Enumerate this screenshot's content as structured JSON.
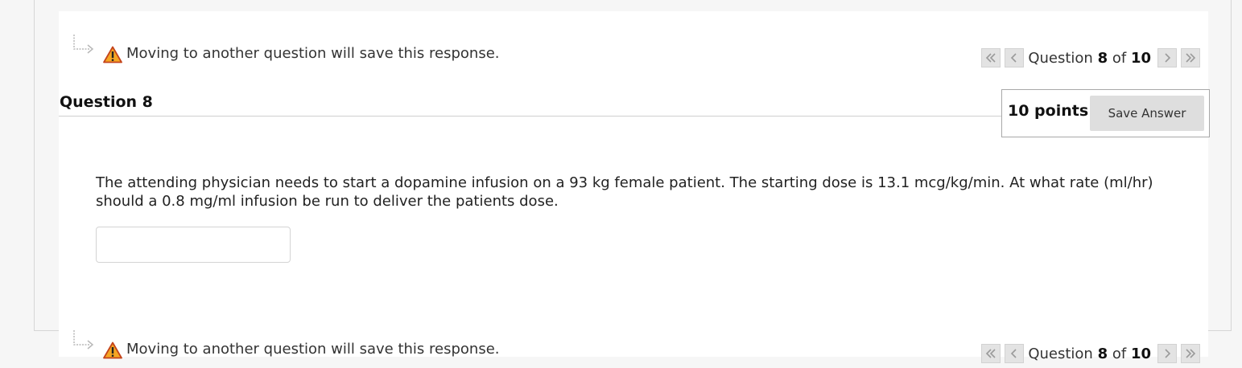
{
  "nav": {
    "warning_text": "Moving to another question will save this response.",
    "question_label": "Question",
    "current": "8",
    "of_label": "of",
    "total": "10"
  },
  "question": {
    "title": "Question 8",
    "points": "10 points",
    "save_label": "Save Answer",
    "text": "The attending physician needs to start a dopamine infusion on a 93 kg female patient. The starting dose is 13.1 mcg/kg/min. At what rate (ml/hr) should a 0.8 mg/ml infusion be run to deliver the patients dose.",
    "answer_value": ""
  },
  "icons": {
    "hook": "hook-arrow-icon",
    "warning": "warning-icon",
    "first": "double-chevron-left-icon",
    "prev": "chevron-left-icon",
    "next": "chevron-right-icon",
    "last": "double-chevron-right-icon"
  },
  "colors": {
    "warning_fill": "#f5a623",
    "warning_border": "#d9822b",
    "button_bg": "#e3e3e3",
    "save_bg": "#dedede"
  }
}
